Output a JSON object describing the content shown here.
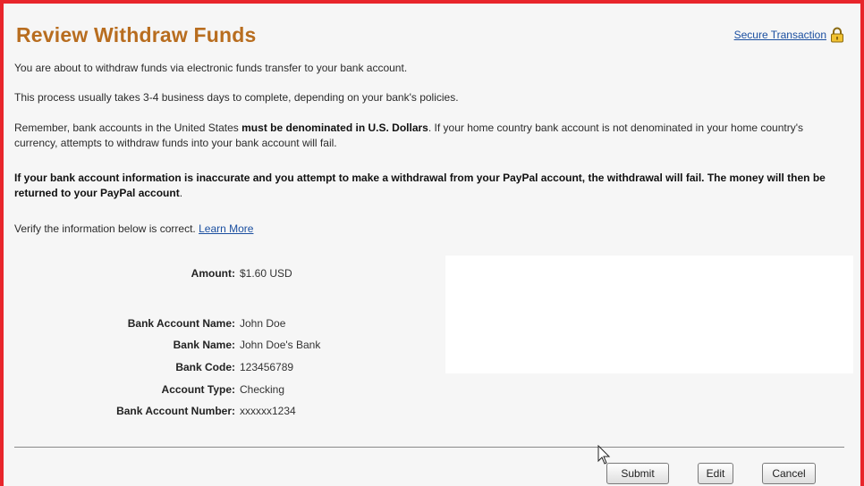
{
  "header": {
    "title": "Review Withdraw Funds",
    "secure_label": "Secure Transaction",
    "lock_icon": "lock-icon"
  },
  "intro": {
    "p1": "You are about to withdraw funds via electronic funds transfer to your bank account.",
    "p2": "This process usually takes 3-4 business days to complete, depending on your bank's policies.",
    "p3_prefix": "Remember, bank accounts in the United States ",
    "p3_bold": "must be denominated in U.S. Dollars",
    "p3_suffix": ". If your home country bank account is not denominated in your home country's currency, attempts to withdraw funds into your bank account will fail.",
    "warning": "If your bank account information is inaccurate and you attempt to make a withdrawal from your PayPal account, the withdrawal will fail. The money will then be returned to your PayPal account",
    "warning_suffix": ".",
    "verify_text": "Verify the information below is correct. ",
    "learn_more": "Learn More"
  },
  "details": {
    "amount_label": "Amount:",
    "amount_value": "$1.60 USD",
    "bank_account_name_label": "Bank Account Name:",
    "bank_account_name_value": "John Doe",
    "bank_name_label": "Bank Name:",
    "bank_name_value": "John Doe's Bank",
    "bank_code_label": "Bank Code:",
    "bank_code_value": "123456789",
    "account_type_label": "Account Type:",
    "account_type_value": "Checking",
    "bank_account_number_label": "Bank Account Number:",
    "bank_account_number_value": "xxxxxx1234"
  },
  "actions": {
    "submit": "Submit",
    "edit": "Edit",
    "cancel": "Cancel"
  },
  "colors": {
    "frame_border": "#e8252b",
    "title": "#b86d1f",
    "link": "#1b4fa0"
  }
}
